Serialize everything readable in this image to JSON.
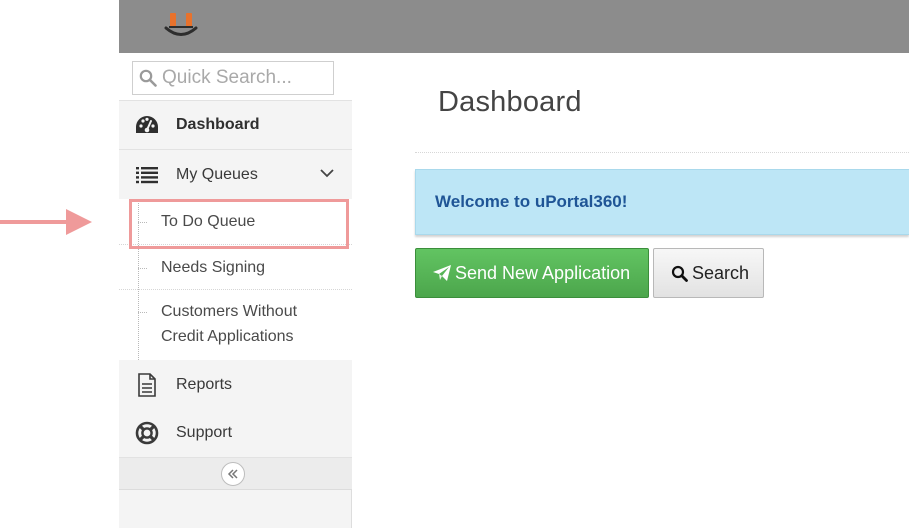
{
  "search": {
    "placeholder": "Quick Search..."
  },
  "sidebar": {
    "items": [
      {
        "label": "Dashboard",
        "icon": "dashboard-gauge-icon"
      },
      {
        "label": "My Queues",
        "icon": "list-icon",
        "expanded": true,
        "children": [
          {
            "label": "To Do Queue"
          },
          {
            "label": "Needs Signing"
          },
          {
            "label": "Customers Without Credit Applications"
          }
        ]
      },
      {
        "label": "Reports",
        "icon": "document-icon"
      },
      {
        "label": "Support",
        "icon": "life-ring-icon"
      }
    ],
    "collapse_icon": "double-chevron-left-icon"
  },
  "main": {
    "title": "Dashboard",
    "alert": "Welcome to uPortal360!",
    "buttons": {
      "send": "Send New Application",
      "search": "Search"
    }
  },
  "colors": {
    "topbar": "#8c8c8c",
    "alert_bg": "#bde6f6",
    "alert_text": "#1f5596",
    "send_button": "#4cae4c",
    "highlight": "#ef9a9a",
    "logo_orange": "#e8722c"
  },
  "annotation": {
    "arrow_icon": "pointer-arrow-icon",
    "highlighted_item": "To Do Queue"
  }
}
